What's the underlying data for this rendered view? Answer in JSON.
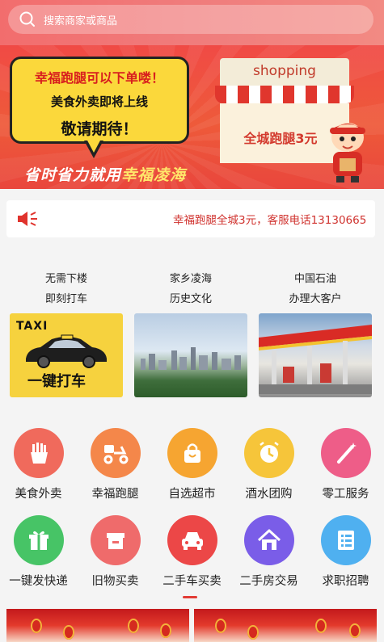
{
  "search": {
    "placeholder": "搜索商家或商品"
  },
  "banner": {
    "bubble_line1": "幸福跑腿可以下单喽！",
    "bubble_line2": "美食外卖即将上线",
    "bubble_line3": "敬请期待！",
    "slogan_prefix": "省时省力就用",
    "slogan_brand": "幸福凌海",
    "shop_sign": "shopping",
    "shop_text": "全城跑腿3元"
  },
  "notice": {
    "text": "幸福跑腿全城3元，客服电话13130665"
  },
  "cards": [
    {
      "line1": "无需下楼",
      "line2": "即刻打车",
      "image_word": "TAXI",
      "image_label": "一键打车"
    },
    {
      "line1": "家乡凌海",
      "line2": "历史文化"
    },
    {
      "line1": "中国石油",
      "line2": "办理大客户"
    }
  ],
  "services": [
    {
      "label": "美食外卖",
      "icon": "fries-icon",
      "color": "#f06a5c"
    },
    {
      "label": "幸福跑腿",
      "icon": "scooter-icon",
      "color": "#f4874a"
    },
    {
      "label": "自选超市",
      "icon": "shopping-bag-icon",
      "color": "#f6a531"
    },
    {
      "label": "酒水团购",
      "icon": "clock-icon",
      "color": "#f6c53a"
    },
    {
      "label": "零工服务",
      "icon": "magic-wand-icon",
      "color": "#ee5d88"
    },
    {
      "label": "一键发快递",
      "icon": "gift-box-icon",
      "color": "#47c466"
    },
    {
      "label": "旧物买卖",
      "icon": "box-icon",
      "color": "#ef6b6b"
    },
    {
      "label": "二手车买卖",
      "icon": "car-icon",
      "color": "#ec4747"
    },
    {
      "label": "二手房交易",
      "icon": "house-icon",
      "color": "#7a5de8"
    },
    {
      "label": "求职招聘",
      "icon": "resume-icon",
      "color": "#4fb0f0"
    }
  ]
}
